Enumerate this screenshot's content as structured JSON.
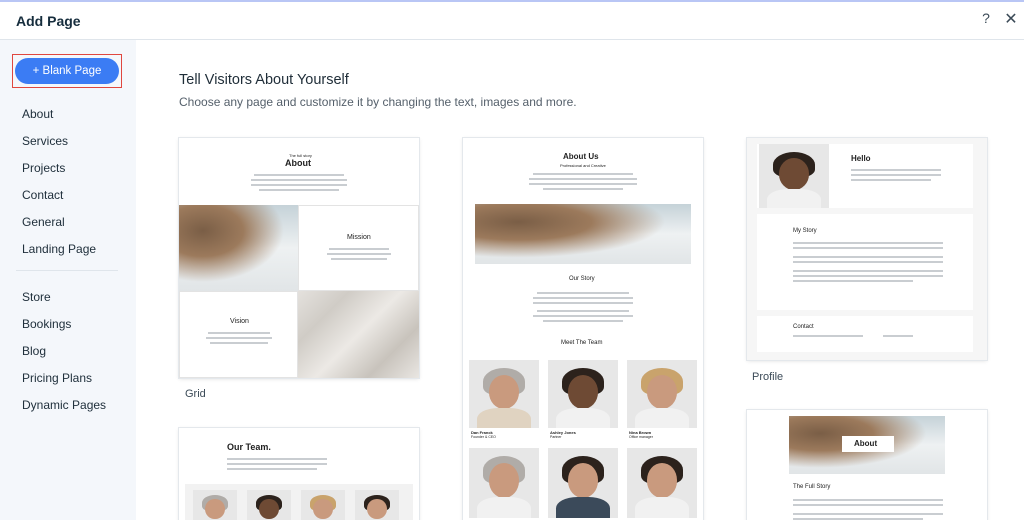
{
  "header": {
    "title": "Add Page",
    "help_icon": "?",
    "close_icon": "✕"
  },
  "sidebar": {
    "blank_button": "+ Blank Page",
    "items": [
      "About",
      "Services",
      "Projects",
      "Contact",
      "General",
      "Landing Page"
    ],
    "items2": [
      "Store",
      "Bookings",
      "Blog",
      "Pricing Plans",
      "Dynamic Pages"
    ]
  },
  "main": {
    "heading": "Tell Visitors About Yourself",
    "subheading": "Choose any page and customize it by changing the text, images and more.",
    "templates": [
      {
        "caption": "Grid",
        "preview": {
          "eyebrow": "The full story",
          "title": "About",
          "mission": "Mission",
          "vision": "Vision"
        }
      },
      {
        "caption": "",
        "preview": {
          "title": "About Us",
          "subtitle": "Professional and Creative",
          "our_story": "Our Story",
          "meet_team": "Meet The Team",
          "members": [
            {
              "name": "Dan Franck",
              "role": "Founder & CEO"
            },
            {
              "name": "Ashley Jones",
              "role": "Partner"
            },
            {
              "name": "Nina Brown",
              "role": "Office manager"
            }
          ]
        }
      },
      {
        "caption": "Profile",
        "preview": {
          "hello": "Hello",
          "my_story": "My Story",
          "contact": "Contact"
        }
      },
      {
        "caption": "",
        "preview": {
          "title": "Our Team."
        }
      },
      {
        "caption": "",
        "preview": {
          "about": "About",
          "full_story": "The Full Story"
        }
      }
    ]
  }
}
